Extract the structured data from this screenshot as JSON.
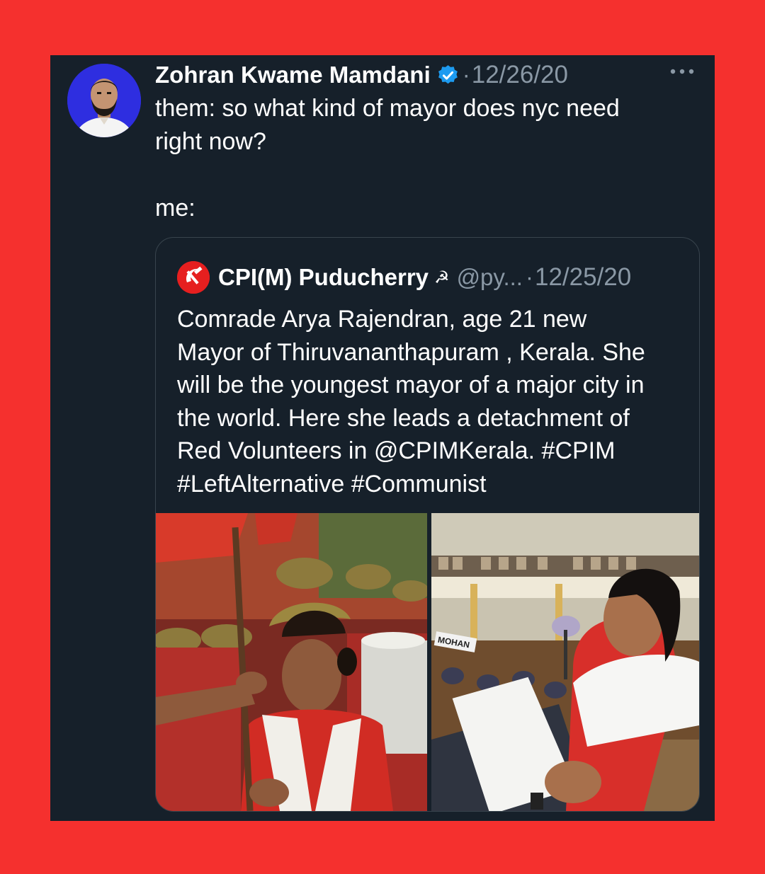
{
  "tweet": {
    "author": "Zohran Kwame Mamdani",
    "separator": "·",
    "date": "12/26/20",
    "text_lines": [
      "them: so what kind of mayor does nyc need",
      "right now?",
      "me:"
    ],
    "icons": {
      "avatar": "profile-photo",
      "verified": "verified-badge-icon",
      "more": "more-options-icon"
    }
  },
  "quote": {
    "author": "CPI(M) Puducherry",
    "emoji": "☭",
    "handle": "@py...",
    "separator": "·",
    "date": "12/25/20",
    "text_lines": [
      "Comrade Arya Rajendran, age 21  new",
      "Mayor of Thiruvananthapuram , Kerala. She",
      "will be the youngest mayor of a major city in",
      "the world. Here she leads a detachment of",
      "Red Volunteers in @CPIMKerala. #CPIM",
      "#LeftAlternative #Communist"
    ],
    "photos": {
      "left": "red-volunteers-march-photo",
      "right": "council-chamber-speech-photo",
      "right_nameplate": "MOHAN"
    },
    "icons": {
      "logo": "hammer-sickle-logo"
    }
  },
  "colors": {
    "frame": "#f5302e",
    "card": "#16202a",
    "text": "#ffffff",
    "muted": "#8a98a5",
    "verified": "#1d9bf0",
    "border": "#38444d"
  }
}
